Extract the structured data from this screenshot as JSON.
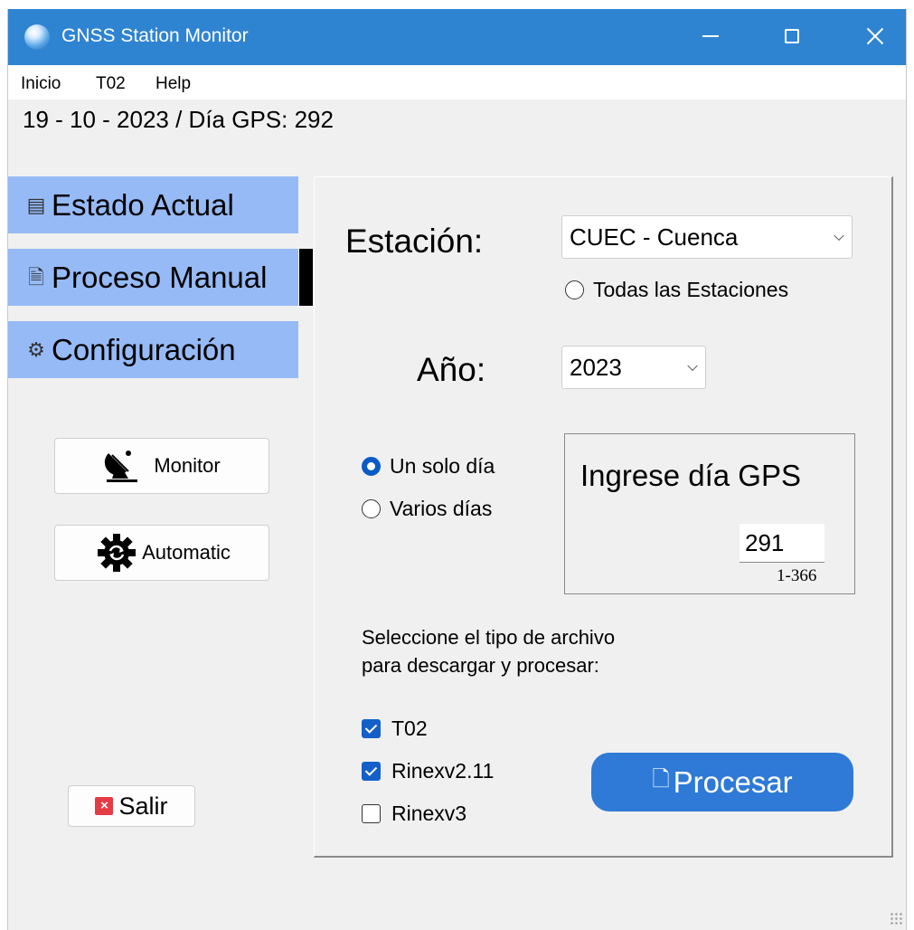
{
  "window": {
    "title": "GNSS Station Monitor",
    "accent_color": "#2f84d2",
    "controls": {
      "minimize_icon": "minimize-icon",
      "maximize_icon": "maximize-icon",
      "close_icon": "close-icon"
    }
  },
  "menu": {
    "items": [
      "Inicio",
      "T02",
      "Help"
    ]
  },
  "date_line": "19 - 10 - 2023 / Día GPS: 292",
  "sidebar": {
    "nav_color": "#96baf6",
    "items": [
      {
        "label": "Estado Actual",
        "icon": "signal-bars-icon"
      },
      {
        "label": "Proceso Manual",
        "icon": "document-download-icon",
        "active": true
      },
      {
        "label": "Configuración",
        "icon": "gear-icon"
      }
    ],
    "buttons": {
      "monitor": {
        "label": "Monitor",
        "icon": "satellite-dish-icon"
      },
      "automatic": {
        "label": "Automatic",
        "icon": "gear-sync-icon"
      },
      "exit": {
        "label": "Salir",
        "icon": "close-square-icon"
      }
    }
  },
  "form": {
    "station_label": "Estación:",
    "station_value": "CUEC - Cuenca",
    "all_stations_label": "Todas las Estaciones",
    "year_label": "Año:",
    "year_value": "2023",
    "mode_single_label": "Un solo día",
    "mode_multi_label": "Varios días",
    "mode_selected": "single",
    "day_box_title": "Ingrese día GPS",
    "day_value": "291",
    "day_range": "1-366",
    "hint_line1": "Seleccione el tipo de archivo",
    "hint_line2": "para descargar y procesar:",
    "file_types": [
      {
        "label": "T02",
        "checked": true
      },
      {
        "label": "Rinexv2.11",
        "checked": true
      },
      {
        "label": "Rinexv3",
        "checked": false
      }
    ],
    "process_label": "Procesar",
    "process_icon": "copy-files-icon",
    "process_color": "#2e7ad6"
  }
}
